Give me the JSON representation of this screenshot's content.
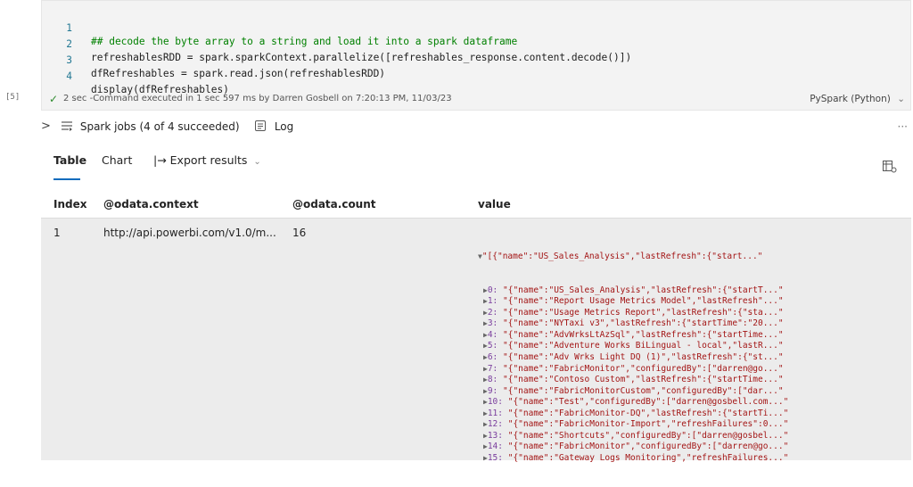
{
  "code_cell": {
    "execution_count": "[5]",
    "lines": [
      {
        "num": "1",
        "text": "## decode the byte array to a string and load it into a spark dataframe",
        "kind": "comment"
      },
      {
        "num": "2",
        "text": "refreshablesRDD = spark.sparkContext.parallelize([refreshables_response.content.decode()])",
        "kind": "plain"
      },
      {
        "num": "3",
        "text": "dfRefreshables = spark.read.json(refreshablesRDD)",
        "kind": "plain"
      },
      {
        "num": "4",
        "text": "display(dfRefreshables)",
        "kind": "plain"
      }
    ],
    "status": "2 sec -Command executed in 1 sec 597 ms by Darren Gosbell on 7:20:13 PM, 11/03/23",
    "language": "PySpark (Python)"
  },
  "output_toolbar": {
    "spark_jobs": "Spark jobs (4 of 4 succeeded)",
    "log": "Log",
    "more": "···"
  },
  "result_tabs": {
    "table": "Table",
    "chart": "Chart",
    "export": "|→ Export results"
  },
  "table": {
    "columns": [
      "Index",
      "@odata.context",
      "@odata.count",
      "value"
    ],
    "row": {
      "index": "1",
      "context": "http://api.powerbi.com/v1.0/m...",
      "count": "16",
      "value_summary": "\"[{\"name\":\"US_Sales_Analysis\",\"lastRefresh\":{\"start...\"",
      "items": [
        {
          "key": "0:",
          "value": "\"{\"name\":\"US_Sales_Analysis\",\"lastRefresh\":{\"startT...\""
        },
        {
          "key": "1:",
          "value": "\"{\"name\":\"Report Usage Metrics Model\",\"lastRefresh\"...\""
        },
        {
          "key": "2:",
          "value": "\"{\"name\":\"Usage Metrics Report\",\"lastRefresh\":{\"sta...\""
        },
        {
          "key": "3:",
          "value": "\"{\"name\":\"NYTaxi v3\",\"lastRefresh\":{\"startTime\":\"20...\""
        },
        {
          "key": "4:",
          "value": "\"{\"name\":\"AdvWrksLtAzSql\",\"lastRefresh\":{\"startTime...\""
        },
        {
          "key": "5:",
          "value": "\"{\"name\":\"Adventure Works BiLingual - local\",\"lastR...\""
        },
        {
          "key": "6:",
          "value": "\"{\"name\":\"Adv Wrks Light DQ (1)\",\"lastRefresh\":{\"st...\""
        },
        {
          "key": "7:",
          "value": "\"{\"name\":\"FabricMonitor\",\"configuredBy\":[\"darren@go...\""
        },
        {
          "key": "8:",
          "value": "\"{\"name\":\"Contoso Custom\",\"lastRefresh\":{\"startTime...\""
        },
        {
          "key": "9:",
          "value": "\"{\"name\":\"FabricMonitorCustom\",\"configuredBy\":[\"dar...\""
        },
        {
          "key": "10:",
          "value": "\"{\"name\":\"Test\",\"configuredBy\":[\"darren@gosbell.com...\""
        },
        {
          "key": "11:",
          "value": "\"{\"name\":\"FabricMonitor-DQ\",\"lastRefresh\":{\"startTi...\""
        },
        {
          "key": "12:",
          "value": "\"{\"name\":\"FabricMonitor-Import\",\"refreshFailures\":0...\""
        },
        {
          "key": "13:",
          "value": "\"{\"name\":\"Shortcuts\",\"configuredBy\":[\"darren@gosbel...\""
        },
        {
          "key": "14:",
          "value": "\"{\"name\":\"FabricMonitor\",\"configuredBy\":[\"darren@go...\""
        },
        {
          "key": "15:",
          "value": "\"{\"name\":\"Gateway Logs Monitoring\",\"refreshFailures...\""
        }
      ]
    }
  },
  "colors": {
    "accent": "#0f6cbd",
    "success": "#2e8b2e",
    "comment": "#008000",
    "json_key": "#7a3e9d",
    "json_string": "#a31515"
  }
}
